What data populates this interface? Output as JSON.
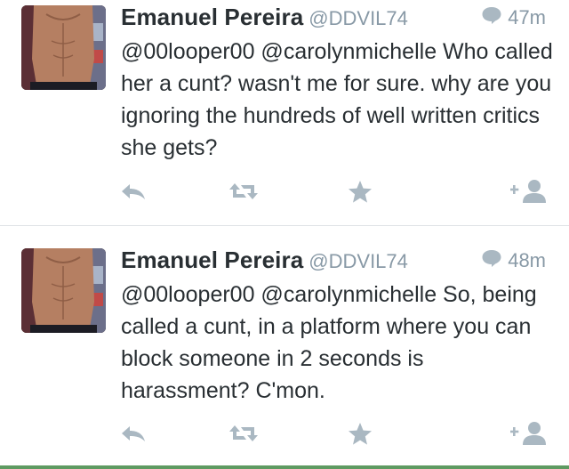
{
  "tweets": [
    {
      "name": "Emanuel Pereira",
      "handle": "@DDVIL74",
      "time": "47m",
      "text": "@00looper00 @carolynmichelle Who called her a cunt? wasn't me for sure. why are you ignoring the hundreds of well written critics she gets?",
      "conversation_icon": "speech-bubble-icon",
      "actions": [
        "reply-icon",
        "retweet-icon",
        "favorite-star-icon",
        "follow-add-user-icon"
      ]
    },
    {
      "name": "Emanuel Pereira",
      "handle": "@DDVIL74",
      "time": "48m",
      "text": "@00looper00 @carolynmichelle So, being called a cunt, in a platform where you can block someone in 2 seconds is harassment? C'mon.",
      "conversation_icon": "speech-bubble-icon",
      "actions": [
        "reply-icon",
        "retweet-icon",
        "favorite-star-icon",
        "follow-add-user-icon"
      ]
    }
  ],
  "colors": {
    "text": "#292f33",
    "secondary": "#8899a6",
    "icon": "#aab8c2",
    "divider": "#dfe3e6"
  }
}
